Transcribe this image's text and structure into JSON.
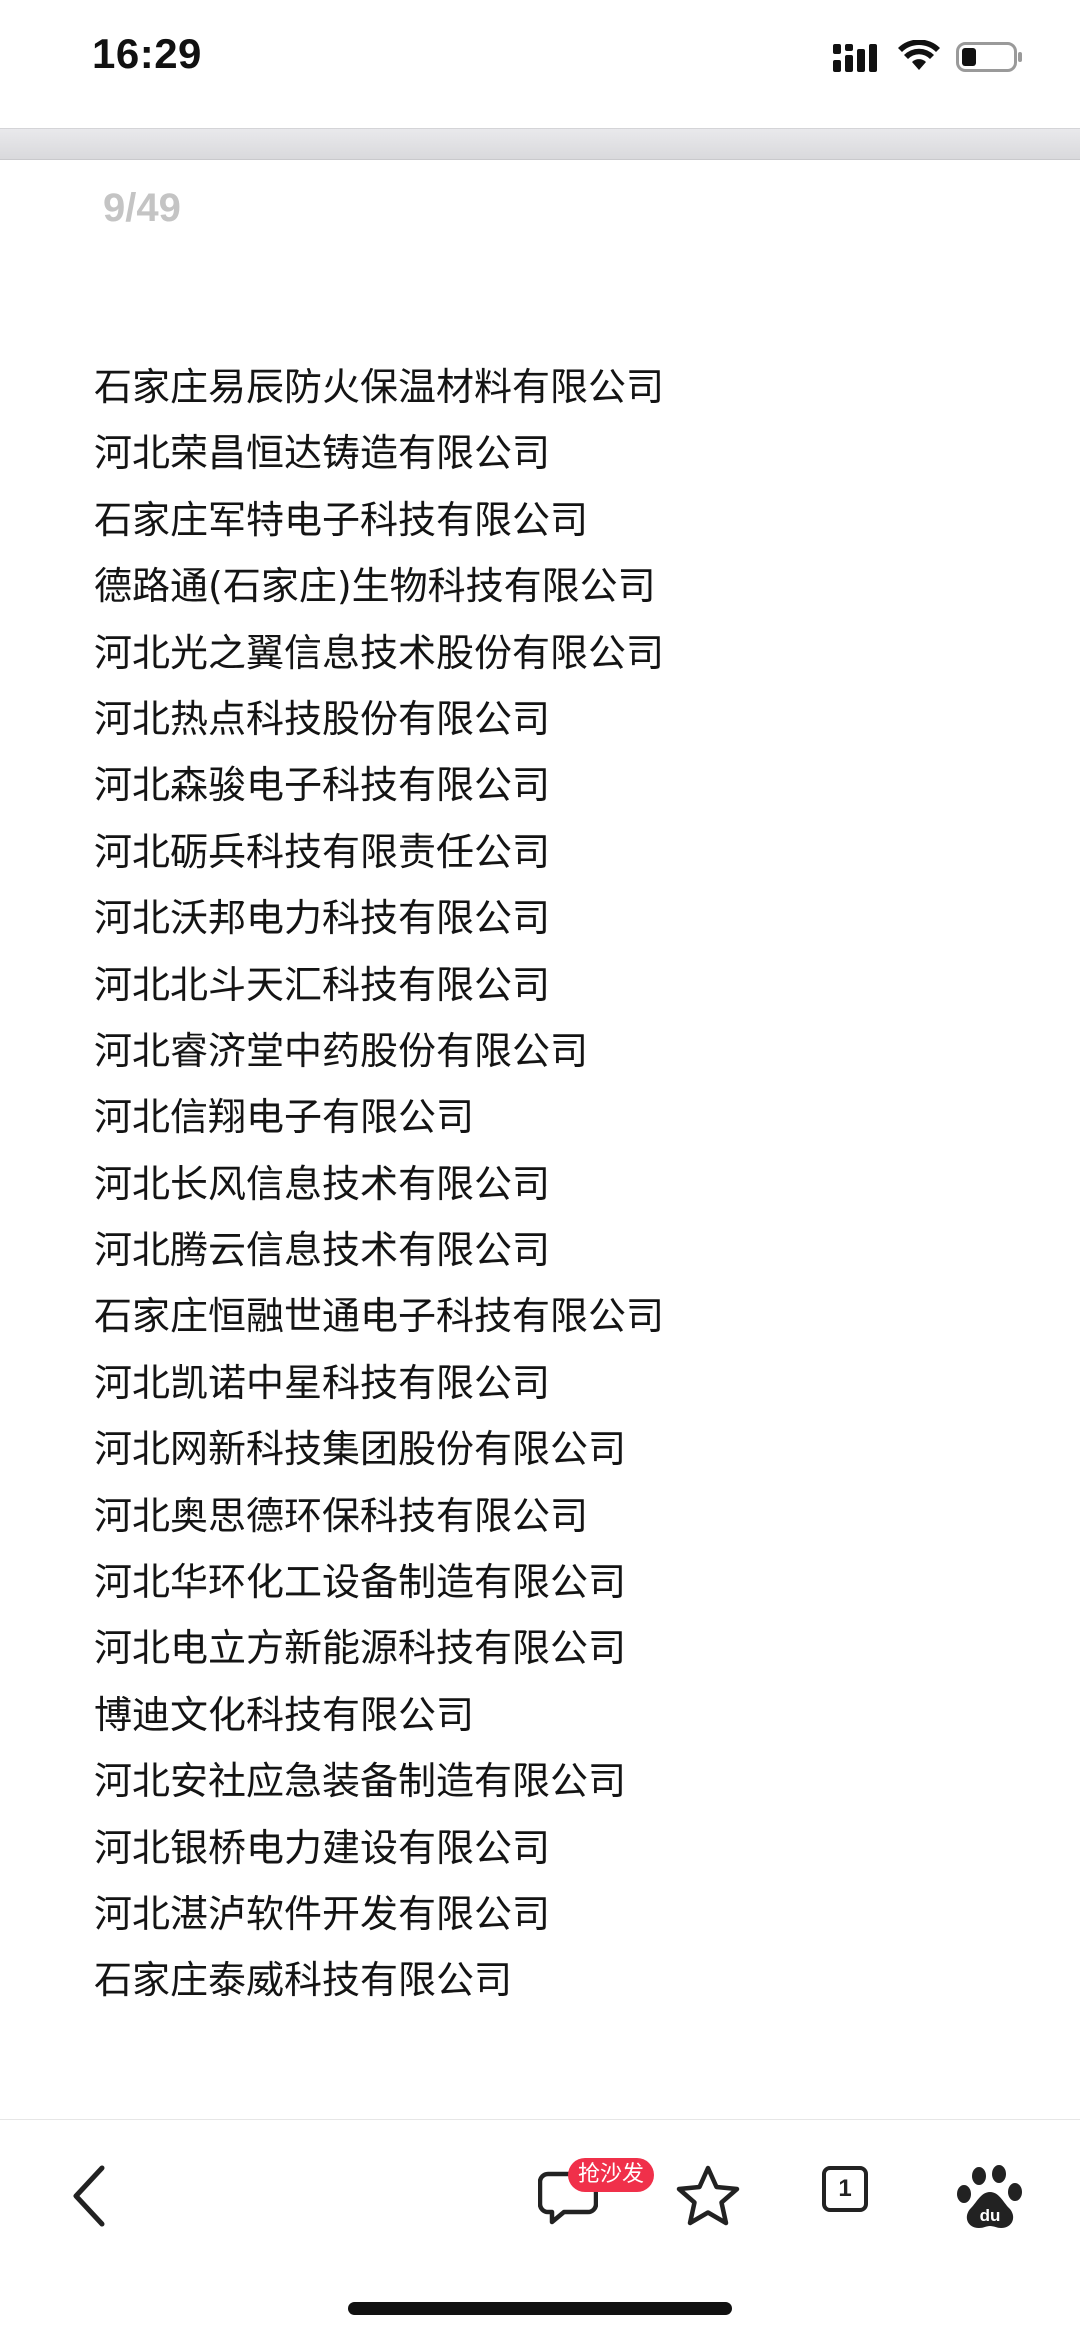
{
  "status_bar": {
    "time": "16:29"
  },
  "page_counter": "9/49",
  "companies": [
    "石家庄易辰防火保温材料有限公司",
    "河北荣昌恒达铸造有限公司",
    "石家庄军特电子科技有限公司",
    "德路通(石家庄)生物科技有限公司",
    "河北光之翼信息技术股份有限公司",
    "河北热点科技股份有限公司",
    "河北森骏电子科技有限公司",
    "河北砺兵科技有限责任公司",
    "河北沃邦电力科技有限公司",
    "河北北斗天汇科技有限公司",
    "河北睿济堂中药股份有限公司",
    "河北信翔电子有限公司",
    "河北长风信息技术有限公司",
    "河北腾云信息技术有限公司",
    "石家庄恒融世通电子科技有限公司",
    "河北凯诺中星科技有限公司",
    "河北网新科技集团股份有限公司",
    "河北奥思德环保科技有限公司",
    "河北华环化工设备制造有限公司",
    "河北电立方新能源科技有限公司",
    "博迪文化科技有限公司",
    "河北安社应急装备制造有限公司",
    "河北银桥电力建设有限公司",
    "河北湛泸软件开发有限公司",
    "石家庄泰威科技有限公司"
  ],
  "toolbar": {
    "sofa_badge": "抢沙发",
    "tab_count": "1",
    "icons": {
      "back": "chevron-left-icon",
      "comment": "comment-icon",
      "favorite": "star-icon",
      "tabs": "tabs-icon",
      "baidu": "baidu-paw-icon"
    }
  },
  "colors": {
    "badge": "#f0304a",
    "page_counter": "#c4c4c4",
    "text": "#141414"
  }
}
